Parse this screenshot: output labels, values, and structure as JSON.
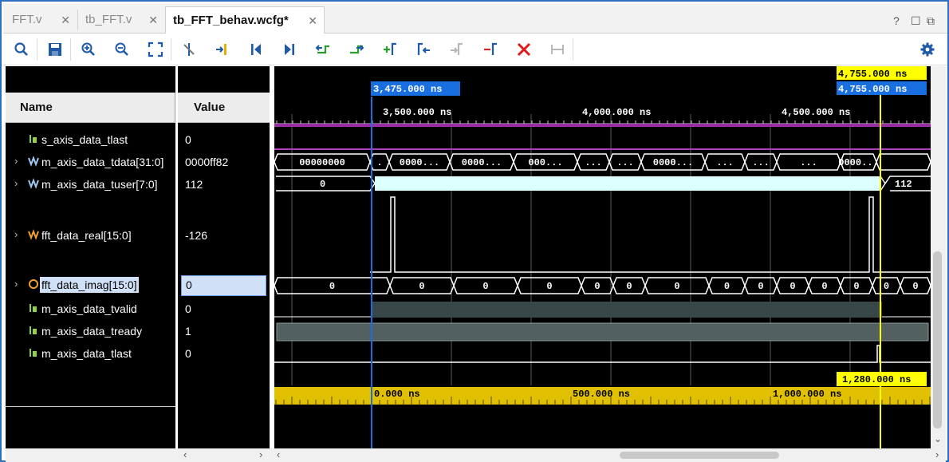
{
  "tabs": [
    {
      "label": "FFT.v",
      "active": false
    },
    {
      "label": "tb_FFT.v",
      "active": false
    },
    {
      "label": "tb_FFT_behav.wcfg*",
      "active": true
    }
  ],
  "window_controls": {
    "help": "?",
    "restore": "☐",
    "float": "⧉"
  },
  "toolbar_icons": [
    "search-icon",
    "save-icon",
    "zoom-in-icon",
    "zoom-out-icon",
    "zoom-fit-icon",
    "cursor-snap-icon",
    "goto-cursor-icon",
    "goto-start-icon",
    "goto-end-icon",
    "prev-transition-icon",
    "next-transition-icon",
    "add-marker-icon",
    "prev-marker-icon",
    "next-marker-icon",
    "swap-cursors-icon",
    "delete-markers-icon",
    "group-icon",
    "settings-icon"
  ],
  "columns": {
    "name": "Name",
    "value": "Value"
  },
  "signals": [
    {
      "name": "s_axis_data_tlast",
      "value": "0",
      "type": "bit",
      "expandable": false
    },
    {
      "name": "m_axis_data_tdata[31:0]",
      "value": "0000ff82",
      "type": "bus",
      "expandable": true
    },
    {
      "name": "m_axis_data_tuser[7:0]",
      "value": "112",
      "type": "bus",
      "expandable": true
    },
    {
      "name": "fft_data_real[15:0]",
      "value": "-126",
      "type": "analog",
      "expandable": true
    },
    {
      "name": "fft_data_imag[15:0]",
      "value": "0",
      "type": "analog",
      "expandable": true,
      "selected": true
    },
    {
      "name": "m_axis_data_tvalid",
      "value": "0",
      "type": "bit",
      "expandable": false
    },
    {
      "name": "m_axis_data_tready",
      "value": "1",
      "type": "bit",
      "expandable": false
    },
    {
      "name": "m_axis_data_tlast",
      "value": "0",
      "type": "bit",
      "expandable": false
    }
  ],
  "cursors": {
    "main": "3,475.000 ns",
    "secondary_top": "4,755.000 ns",
    "secondary_bottom": "4,755.000 ns",
    "delta": "1,280.000 ns"
  },
  "time_ruler": {
    "labels": [
      "3,500.000 ns",
      "4,000.000 ns",
      "4,500.000 ns"
    ]
  },
  "delta_ruler": {
    "labels": [
      "0.000 ns",
      "500.000 ns",
      "1,000.000 ns"
    ]
  },
  "tdata_values": [
    "00000000",
    ".",
    "0000...",
    "0000...",
    "000...",
    "...",
    "...",
    "0000...",
    "...",
    "...",
    "...",
    "0000..."
  ],
  "tuser_values": [
    "0",
    "112"
  ],
  "imag_values": [
    "0",
    "0",
    "0",
    "0",
    "0",
    "0",
    "0",
    "0",
    "0",
    "0",
    "0",
    "0",
    "0",
    "0"
  ],
  "colors": {
    "cursor_blue": "#1a6fe0",
    "marker_yellow": "#ffff00",
    "tuser_fill": "#dcffff",
    "tvalid_fill": "#384848",
    "ruler_gold": "#e0c000",
    "bus_purple": "#b040c0"
  }
}
